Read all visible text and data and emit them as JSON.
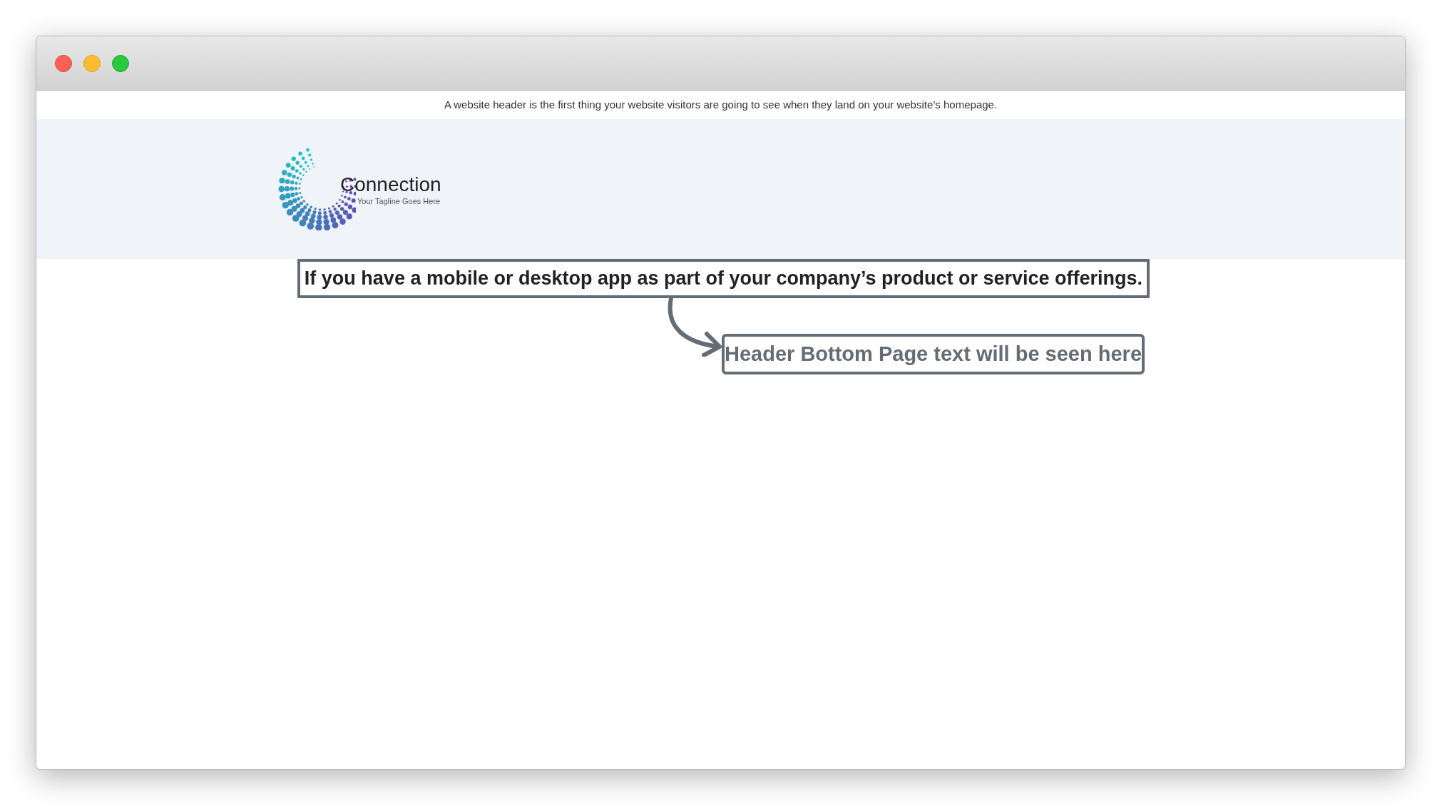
{
  "intro": "A website header is the first thing your website visitors are going to see when they land on your website’s homepage.",
  "logo": {
    "name": "Connection",
    "tagline": "Your Tagline Goes Here"
  },
  "callout": "If you have a mobile or desktop app as part of your company’s product or service offerings.",
  "note": "Header Bottom Page text will be seen here"
}
